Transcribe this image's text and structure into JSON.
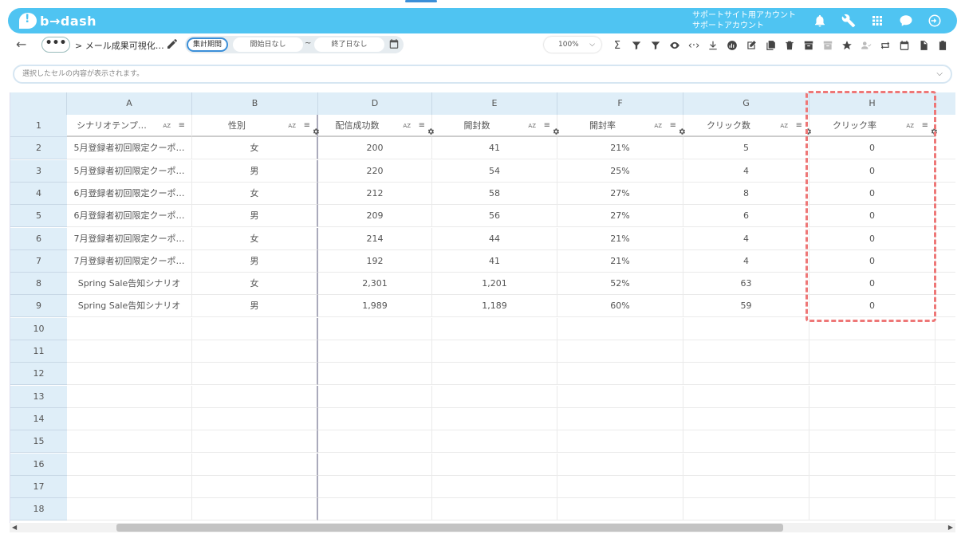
{
  "app": {
    "logo_text": "b→dash"
  },
  "header": {
    "account_line1": "サポートサイト用アカウント",
    "account_line2": "サポートアカウント",
    "icons": [
      "bell-icon",
      "wrench-icon",
      "apps-grid-icon",
      "chat-icon",
      "logout-icon"
    ]
  },
  "toolbar": {
    "back": "←",
    "more": "•••",
    "breadcrumb": "> メール成果可視化…",
    "period_label": "集計期間",
    "start_date": "開始日なし",
    "tilde": "~",
    "end_date": "終了日なし",
    "zoom": "100%"
  },
  "cellbar": {
    "placeholder": "選択したセルの内容が表示されます。"
  },
  "sheet": {
    "columns": [
      "A",
      "B",
      "D",
      "E",
      "F",
      "G",
      "H"
    ],
    "headers": [
      "シナリオテンプ…",
      "性別",
      "配信成功数",
      "開封数",
      "開封率",
      "クリック数",
      "クリック率"
    ],
    "header_az": "AZ",
    "row_numbers": [
      "1",
      "2",
      "3",
      "4",
      "5",
      "6",
      "7",
      "8",
      "9",
      "10",
      "11",
      "12",
      "13",
      "14",
      "15",
      "16",
      "17",
      "18"
    ],
    "rows": [
      [
        "5月登録者初回限定クーポ…",
        "女",
        "200",
        "41",
        "21%",
        "5",
        "0"
      ],
      [
        "5月登録者初回限定クーポ…",
        "男",
        "220",
        "54",
        "25%",
        "4",
        "0"
      ],
      [
        "6月登録者初回限定クーポ…",
        "女",
        "212",
        "58",
        "27%",
        "8",
        "0"
      ],
      [
        "6月登録者初回限定クーポ…",
        "男",
        "209",
        "56",
        "27%",
        "6",
        "0"
      ],
      [
        "7月登録者初回限定クーポ…",
        "女",
        "214",
        "44",
        "21%",
        "4",
        "0"
      ],
      [
        "7月登録者初回限定クーポ…",
        "男",
        "192",
        "41",
        "21%",
        "4",
        "0"
      ],
      [
        "Spring Sale告知シナリオ",
        "女",
        "2,301",
        "1,201",
        "52%",
        "63",
        "0"
      ],
      [
        "Spring Sale告知シナリオ",
        "男",
        "1,989",
        "1,189",
        "60%",
        "59",
        "0"
      ]
    ]
  },
  "colors": {
    "topbar": "#4fc4f2",
    "header_bg": "#dfeef8",
    "highlight": "#ee7777"
  }
}
